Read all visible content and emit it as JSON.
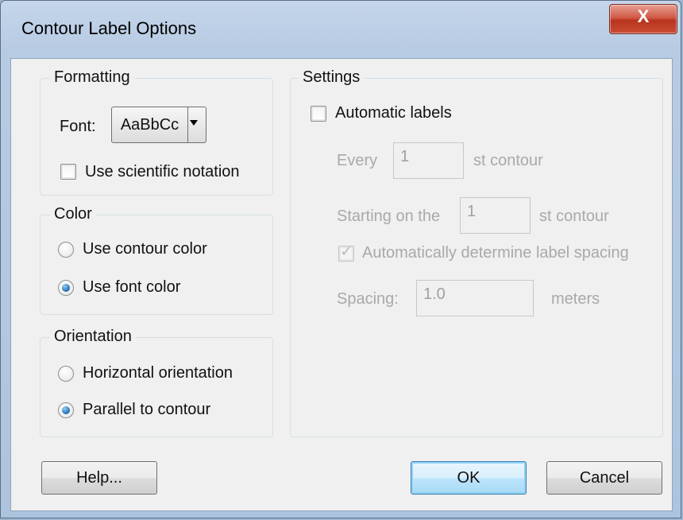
{
  "window": {
    "title": "Contour Label Options",
    "close_glyph": "X"
  },
  "formatting": {
    "legend": "Formatting",
    "font_label": "Font:",
    "font_sample": "AaBbCc",
    "sci_notation_label": "Use scientific notation",
    "sci_notation_checked": false
  },
  "color": {
    "legend": "Color",
    "options": [
      {
        "label": "Use contour color",
        "selected": false
      },
      {
        "label": "Use font color",
        "selected": true
      }
    ]
  },
  "orientation": {
    "legend": "Orientation",
    "options": [
      {
        "label": "Horizontal orientation",
        "selected": false
      },
      {
        "label": "Parallel to contour",
        "selected": true
      }
    ]
  },
  "settings": {
    "legend": "Settings",
    "automatic_label": "Automatic labels",
    "automatic_checked": false,
    "every_label": "Every",
    "every_value": "1",
    "every_suffix": "st contour",
    "starting_label": "Starting on the",
    "starting_value": "1",
    "starting_suffix": "st contour",
    "auto_spacing_label": "Automatically determine label spacing",
    "auto_spacing_checked": true,
    "spacing_label": "Spacing:",
    "spacing_value": "1.0",
    "spacing_unit": "meters"
  },
  "buttons": {
    "help": "Help...",
    "ok": "OK",
    "cancel": "Cancel"
  },
  "colors": {
    "accent": "#3c7fb1",
    "disabled_text": "#a9a9a9",
    "close_button": "#c94d35"
  },
  "icons": {
    "close": "close-icon",
    "dropdown": "chevron-down-icon",
    "checkmark": "checkmark-icon"
  }
}
